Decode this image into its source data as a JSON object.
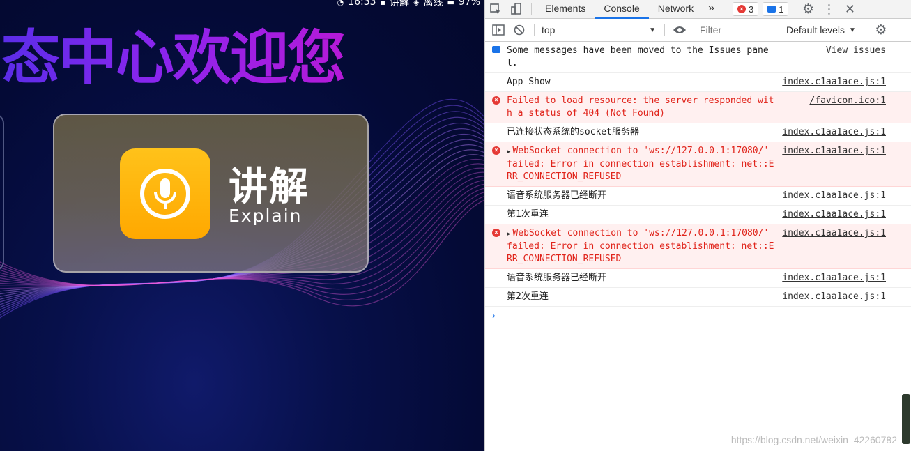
{
  "app": {
    "status_bar": {
      "time": "16:33",
      "app_name": "讲解",
      "network": "离线",
      "battery": "97%"
    },
    "welcome_text": "态中心欢迎您",
    "card": {
      "title": "讲解",
      "subtitle": "Explain",
      "icon": "microphone-icon"
    }
  },
  "devtools": {
    "tabs": [
      "Elements",
      "Console",
      "Network"
    ],
    "active_tab": "Console",
    "more_tabs_label": "»",
    "error_count": "3",
    "message_count": "1",
    "context": "top",
    "filter_placeholder": "Filter",
    "levels_label": "Default levels",
    "messages": [
      {
        "type": "info",
        "text": "Some messages have been moved to the Issues panel.",
        "source": "View issues"
      },
      {
        "type": "log",
        "text": "App Show",
        "source": "index.c1aa1ace.js:1"
      },
      {
        "type": "error",
        "text": "Failed to load resource: the server responded with a status of 404 (Not Found)",
        "source": "/favicon.ico:1"
      },
      {
        "type": "log",
        "text": "已连接状态系统的socket服务器",
        "source": "index.c1aa1ace.js:1"
      },
      {
        "type": "error",
        "expandable": true,
        "text": "WebSocket connection to 'ws://127.0.0.1:17080/' failed: Error in connection establishment: net::ERR_CONNECTION_REFUSED",
        "source": "index.c1aa1ace.js:1"
      },
      {
        "type": "log",
        "text": "语音系统服务器已经断开",
        "source": "index.c1aa1ace.js:1"
      },
      {
        "type": "log",
        "text": "第1次重连",
        "source": "index.c1aa1ace.js:1"
      },
      {
        "type": "error",
        "expandable": true,
        "text": "WebSocket connection to 'ws://127.0.0.1:17080/' failed: Error in connection establishment: net::ERR_CONNECTION_REFUSED",
        "source": "index.c1aa1ace.js:1"
      },
      {
        "type": "log",
        "text": "语音系统服务器已经断开",
        "source": "index.c1aa1ace.js:1"
      },
      {
        "type": "log",
        "text": "第2次重连",
        "source": "index.c1aa1ace.js:1"
      }
    ],
    "prompt_symbol": "›"
  },
  "watermark": "https://blog.csdn.net/weixin_42260782",
  "colors": {
    "accent": "#1a73e8",
    "error": "#e0241b",
    "error_bg": "#fff0f0",
    "icon_yellow": "#ffb300"
  }
}
